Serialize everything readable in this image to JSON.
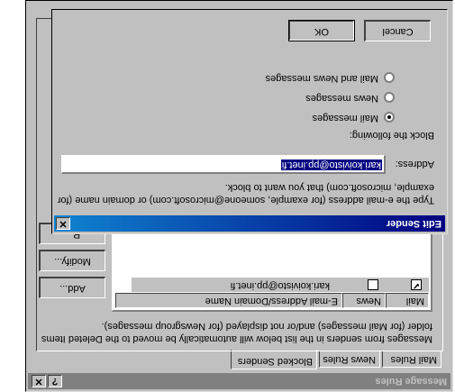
{
  "message_rules": {
    "title": "Message Rules",
    "help_btn": "?",
    "close_btn": "✕",
    "tabs": [
      "Mail Rules",
      "News Rules",
      "Blocked Senders"
    ],
    "description": [
      "Messages from senders in the list below will automatically be moved to the Deleted Items",
      "folder (for Mail messages) and/or not displayed (for Newsgroup messages)."
    ],
    "columns": [
      "Mail",
      "News",
      "E-mail Address/Domain Name"
    ],
    "rows": [
      {
        "mail": "✔",
        "news": "",
        "address": "kari.koivisto@pp.inet.fi"
      }
    ],
    "buttons": {
      "add": "Add...",
      "modify": "Modify...",
      "remove": "R..."
    }
  },
  "edit_sender": {
    "title": "Edit Sender",
    "close_btn": "✕",
    "instructions": [
      "Type the e-mail address (for example, someone@microsoft.com) or domain name (for",
      "example, microsoft.com) that you want to block."
    ],
    "address_label": "Address:",
    "address_value": "kari.koivisto@pp.inet.fi",
    "block_label": "Block the following:",
    "options": [
      "Mail messages",
      "News messages",
      "Mail and News messages"
    ],
    "selected_option": "Mail messages",
    "ok": "OK",
    "cancel": "Cancel"
  },
  "colors": {
    "titlebar_start": "#000080",
    "titlebar_end": "#1084d0",
    "inactive_title": "#808080",
    "face": "#c0c0c0"
  }
}
